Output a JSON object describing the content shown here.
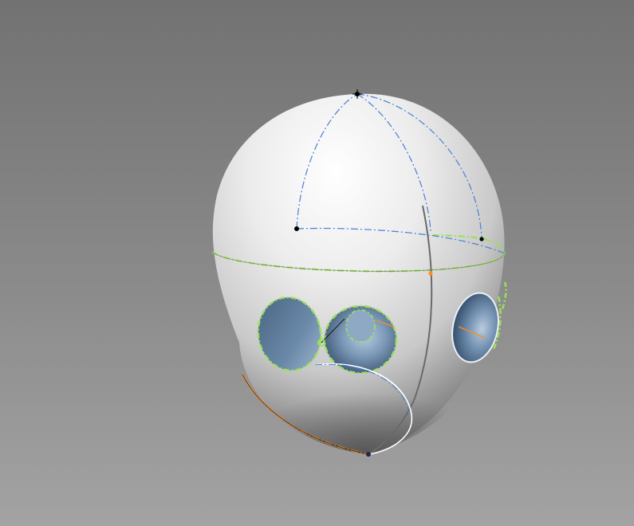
{
  "viewport": {
    "background_top": "#727272",
    "background_bottom": "#a3a3a3"
  },
  "model": {
    "body": "egg-shaped-shell",
    "shell_color": "#e8e8e8",
    "cavity_color": "#5d7a99",
    "openings": 3
  },
  "curves": {
    "selected_edge_color": "#9be05a",
    "feature_curve_color": "#4a7fd6",
    "highlight_edge_color": "#ff8c1a",
    "control_point_color": "#000000"
  }
}
